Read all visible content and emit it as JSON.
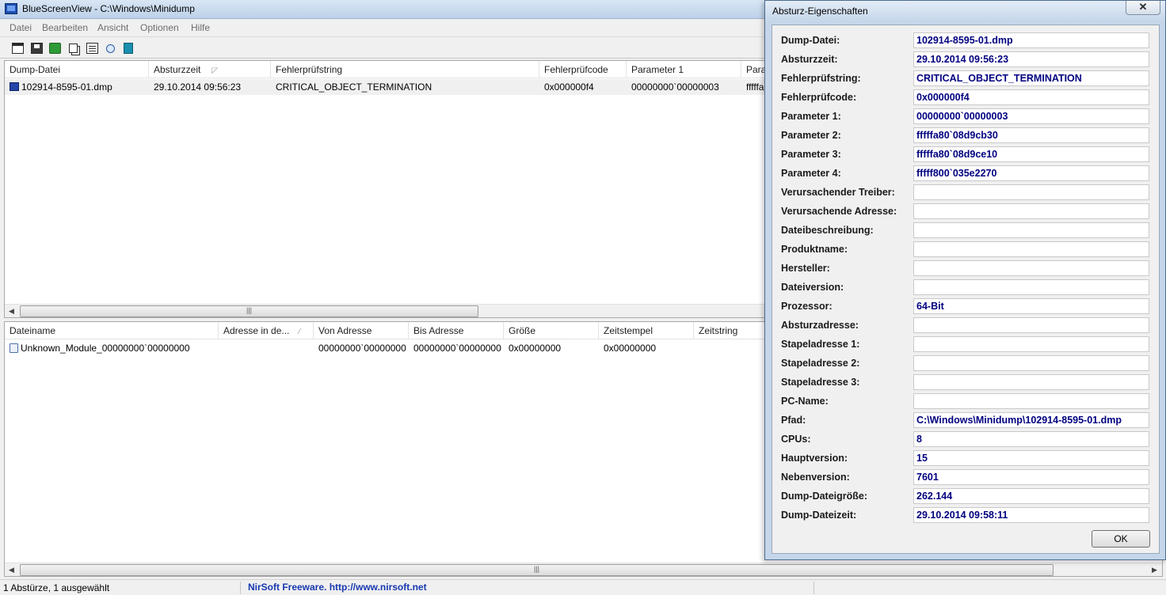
{
  "window": {
    "title": "BlueScreenView  -  C:\\Windows\\Minidump"
  },
  "menu": [
    "Datei",
    "Bearbeiten",
    "Ansicht",
    "Optionen",
    "Hilfe"
  ],
  "toolbar": {
    "icons": [
      "window-icon",
      "save-icon",
      "refresh-icon",
      "copy-icon",
      "properties-icon",
      "find-icon",
      "exit-icon"
    ]
  },
  "upper_list": {
    "columns": [
      "Dump-Datei",
      "Absturzzeit",
      "Fehlerprüfstring",
      "Fehlerprüfcode",
      "Parameter 1",
      "Para"
    ],
    "rows": [
      {
        "dump_file": "102914-8595-01.dmp",
        "crash_time": "29.10.2014 09:56:23",
        "bugcheck_string": "CRITICAL_OBJECT_TERMINATION",
        "bugcheck_code": "0x000000f4",
        "parameter1": "00000000`00000003",
        "parameter2_partial": "fffffa",
        "selected": true
      }
    ]
  },
  "lower_list": {
    "columns": [
      "Dateiname",
      "Adresse in de...",
      "Von Adresse",
      "Bis Adresse",
      "Größe",
      "Zeitstempel",
      "Zeitstring"
    ],
    "rows": [
      {
        "filename": "Unknown_Module_00000000`00000000",
        "address_in": "",
        "from_address": "00000000`00000000",
        "to_address": "00000000`00000000",
        "size": "0x00000000",
        "timestamp": "0x00000000",
        "timestring": ""
      }
    ]
  },
  "status": {
    "count": "1 Abstürze, 1 ausgewählt",
    "nirsoft": "NirSoft Freeware.  http://www.nirsoft.net"
  },
  "dialog": {
    "title": "Absturz-Eigenschaften",
    "close_label": "✕",
    "ok_label": "OK",
    "properties": [
      {
        "label": "Dump-Datei:",
        "value": "102914-8595-01.dmp"
      },
      {
        "label": "Absturzzeit:",
        "value": "29.10.2014 09:56:23"
      },
      {
        "label": "Fehlerprüfstring:",
        "value": "CRITICAL_OBJECT_TERMINATION"
      },
      {
        "label": "Fehlerprüfcode:",
        "value": "0x000000f4"
      },
      {
        "label": "Parameter 1:",
        "value": "00000000`00000003"
      },
      {
        "label": "Parameter 2:",
        "value": "fffffa80`08d9cb30"
      },
      {
        "label": "Parameter 3:",
        "value": "fffffa80`08d9ce10"
      },
      {
        "label": "Parameter 4:",
        "value": "fffff800`035e2270"
      },
      {
        "label": "Verursachender Treiber:",
        "value": ""
      },
      {
        "label": "Verursachende Adresse:",
        "value": ""
      },
      {
        "label": "Dateibeschreibung:",
        "value": ""
      },
      {
        "label": "Produktname:",
        "value": ""
      },
      {
        "label": "Hersteller:",
        "value": ""
      },
      {
        "label": "Dateiversion:",
        "value": ""
      },
      {
        "label": "Prozessor:",
        "value": "64-Bit"
      },
      {
        "label": "Absturzadresse:",
        "value": ""
      },
      {
        "label": "Stapeladresse 1:",
        "value": ""
      },
      {
        "label": "Stapeladresse 2:",
        "value": ""
      },
      {
        "label": "Stapeladresse 3:",
        "value": ""
      },
      {
        "label": "PC-Name:",
        "value": ""
      },
      {
        "label": "Pfad:",
        "value": "C:\\Windows\\Minidump\\102914-8595-01.dmp"
      },
      {
        "label": "CPUs:",
        "value": "8"
      },
      {
        "label": "Hauptversion:",
        "value": "15"
      },
      {
        "label": "Nebenversion:",
        "value": "7601"
      },
      {
        "label": "Dump-Dateigröße:",
        "value": "262.144"
      },
      {
        "label": "Dump-Dateizeit:",
        "value": "29.10.2014 09:58:11"
      }
    ]
  }
}
